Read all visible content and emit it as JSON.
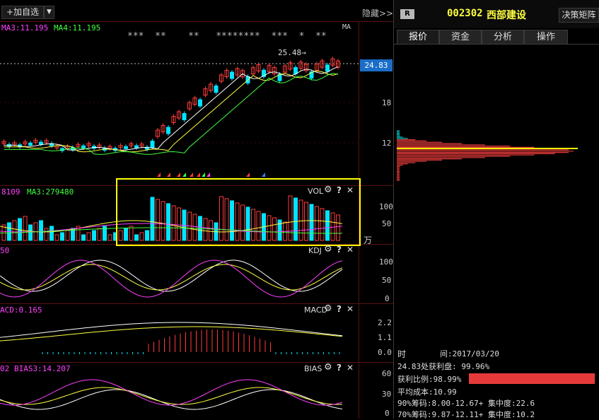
{
  "toolbar": {
    "add_label": "+加自选",
    "dropdown_glyph": "▼",
    "hide_label": "隐藏>>"
  },
  "stock": {
    "badge": "R",
    "code": "002302",
    "name": "西部建设",
    "decision_button": "决策矩阵"
  },
  "tabs": [
    "报价",
    "资金",
    "分析",
    "操作"
  ],
  "price_panel": {
    "ma3_label": "MA3:11.195",
    "ma4_label": "MA4:11.195",
    "ma_tag": "MA",
    "stars": "***  **    **   ********  ***  *  **",
    "high_annotation": "25.48→",
    "current_price": "24.83",
    "axis_labels": [
      "18",
      "12"
    ]
  },
  "vol_panel": {
    "left_label": "8109",
    "ma3_label": "MA3:279480",
    "name": "VOL",
    "axis_labels": [
      "100",
      "50"
    ],
    "unit": "万"
  },
  "kdj_panel": {
    "left_label": "50",
    "name": "KDJ",
    "axis_labels": [
      "100",
      "50",
      "0"
    ]
  },
  "macd_panel": {
    "left_label": "ACD:0.165",
    "name": "MACD",
    "axis_labels": [
      "2.2",
      "1.1",
      "0.0"
    ]
  },
  "bias_panel": {
    "left_label": "02",
    "bias3_label": "BIAS3:14.207",
    "name": "BIAS",
    "axis_labels": [
      "60",
      "30",
      "0"
    ]
  },
  "panel_icons": {
    "gear": "⚙",
    "help": "?",
    "close": "✕"
  },
  "chip_stats": {
    "time_label": "时",
    "time_value": "间:2017/03/20",
    "profit_line": "24.83处获利盘: 99.96%",
    "profit_ratio": "获利比例:98.99%",
    "profit_ratio_value": 0.9899,
    "avg_cost": "平均成本:10.99",
    "chip90": "90%筹码:8.00-12.67+ 集中度:22.6",
    "chip70": "70%筹码:9.87-12.11+ 集中度:10.2"
  },
  "colors": {
    "up": "#ff3b3b",
    "down": "#00e5ff",
    "ma_white": "#ffffff",
    "ma_yellow": "#ffff40",
    "ma_magenta": "#ff40ff",
    "ma_green": "#40ff40",
    "highlight": "#ffff00"
  }
}
